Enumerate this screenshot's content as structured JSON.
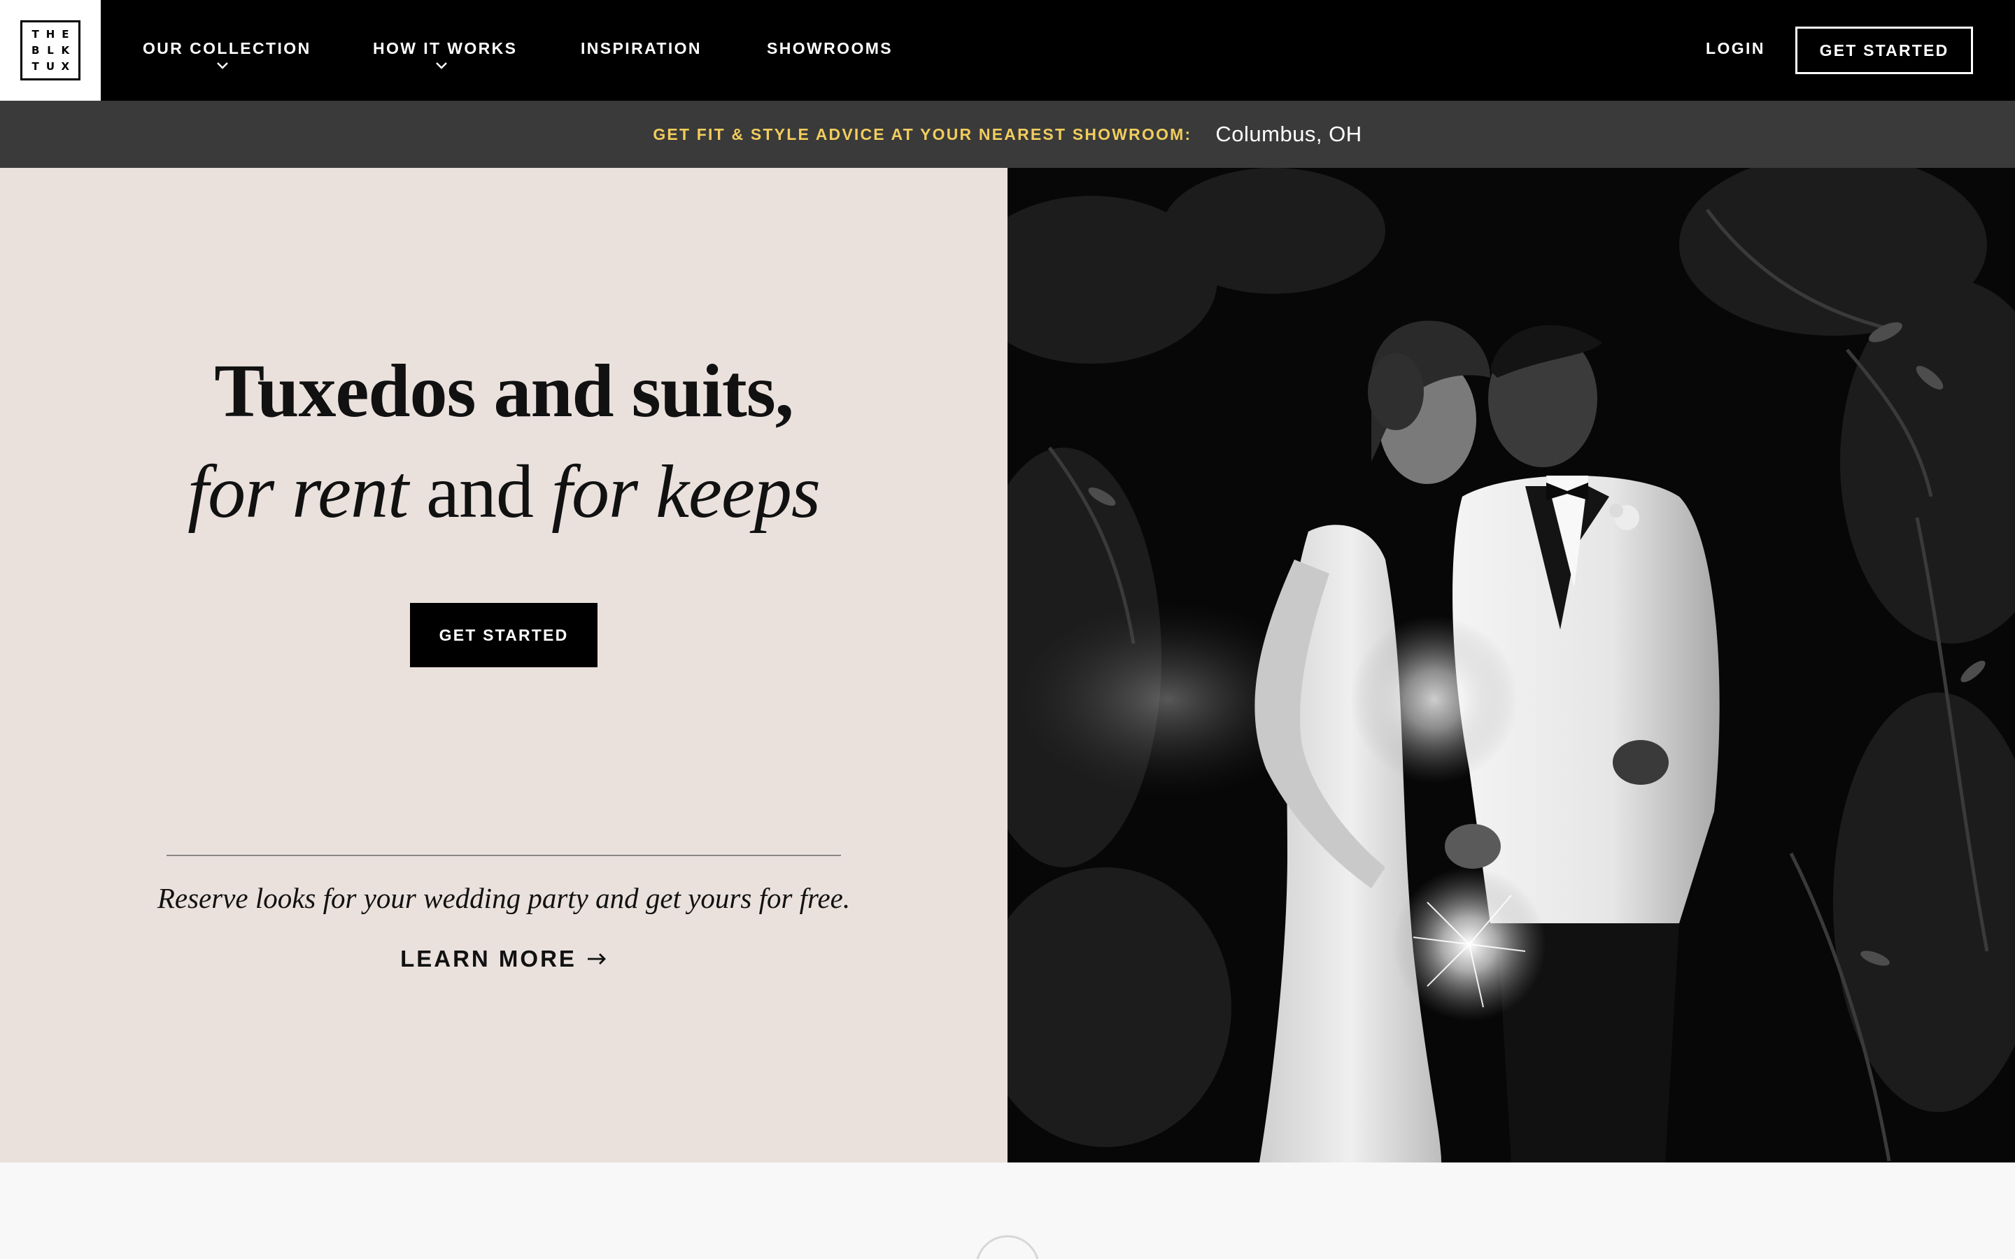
{
  "logo": {
    "letters": [
      "T",
      "H",
      "E",
      "B",
      "L",
      "K",
      "T",
      "U",
      "X"
    ]
  },
  "nav": {
    "items": [
      {
        "label": "OUR COLLECTION",
        "dropdown": true
      },
      {
        "label": "HOW IT WORKS",
        "dropdown": true
      },
      {
        "label": "INSPIRATION",
        "dropdown": false
      },
      {
        "label": "SHOWROOMS",
        "dropdown": false
      }
    ],
    "login_label": "LOGIN",
    "cta_label": "GET STARTED"
  },
  "promo": {
    "label": "GET FIT & STYLE ADVICE AT YOUR NEAREST SHOWROOM:",
    "location": "Columbus, OH"
  },
  "hero": {
    "line1": "Tuxedos and suits,",
    "line2_a": "for rent",
    "line2_b": " and ",
    "line2_c": "for keeps",
    "cta_label": "GET STARTED",
    "reserve_text": "Reserve looks for your wedding party and get yours for free.",
    "learn_more": "LEARN MORE"
  },
  "colors": {
    "nav_bg": "#000000",
    "promo_bg": "#3a3a3a",
    "promo_accent": "#f1cd5d",
    "hero_left_bg": "#eae1dd",
    "page_bg": "#f8f8f8"
  },
  "icons": {
    "dropdown": "chevron-down-icon",
    "arrow": "arrow-right-icon"
  }
}
